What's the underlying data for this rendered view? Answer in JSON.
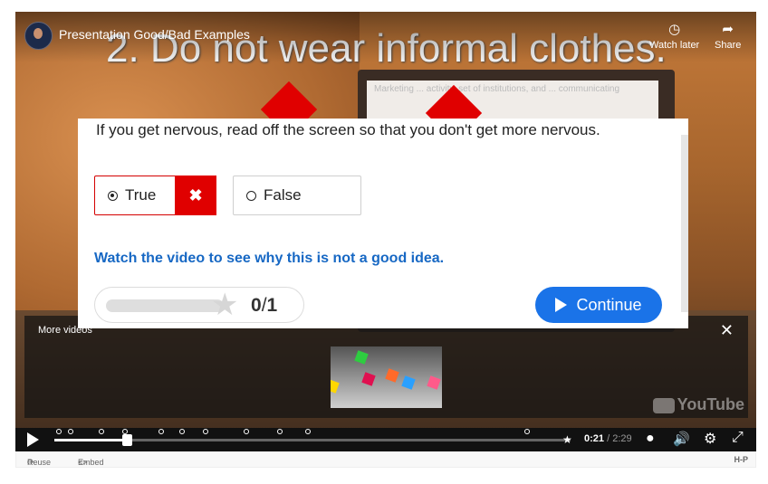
{
  "header": {
    "video_title": "Presentation Good/Bad Examples",
    "watch_later": "Watch later",
    "share": "Share"
  },
  "slide": {
    "headline": "2. Do not wear informal clothes.",
    "screen_text": "Marketing ... activity, set of institutions, and ... communicating"
  },
  "quiz": {
    "question": "If you get nervous, read off the screen so that you don't get more nervous.",
    "options": [
      {
        "label": "True",
        "selected": true,
        "result": "wrong"
      },
      {
        "label": "False",
        "selected": false
      }
    ],
    "wrong_icon": "✖",
    "feedback": "Watch the video to see why this is not a good idea.",
    "score": {
      "earned": "0",
      "sep": "/",
      "total": "1"
    },
    "continue_label": "Continue"
  },
  "more_videos": {
    "title": "More videos",
    "close": "✕",
    "youtube_logo": "YouTube"
  },
  "player": {
    "current_time": "0:21",
    "separator": "/",
    "duration": "2:29",
    "progress_fraction": 0.14
  },
  "footer": {
    "reuse": "Reuse",
    "embed": "Embed",
    "brand": "H-P"
  },
  "colors": {
    "accent_blue": "#1a73e8",
    "feedback_blue": "#1768c4",
    "wrong_red": "#e00000"
  }
}
